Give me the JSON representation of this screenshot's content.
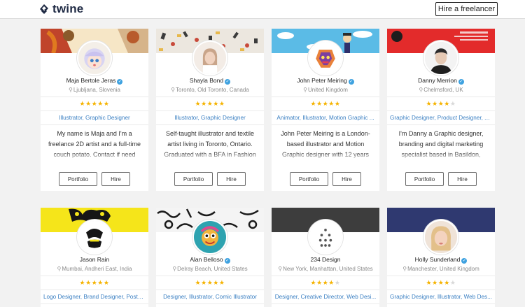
{
  "header": {
    "logo_text": "twine",
    "hire_button": "Hire a freelancer"
  },
  "labels": {
    "portfolio": "Portfolio",
    "hire": "Hire",
    "verified_mark": "✓",
    "pin": "⚲"
  },
  "cards": [
    {
      "name": "Maja Bertole Jeras",
      "location": "Ljubljana, Slovenia",
      "rating": 5,
      "skills": "Illustrator, Graphic Designer",
      "bio": "My name is Maja and I'm a freelance 2D artist and a full-time couch potato. Contact if need"
    },
    {
      "name": "Shayla Bond",
      "location": "Toronto, Old Toronto, Canada",
      "rating": 5,
      "skills": "Illustrator, Graphic Designer",
      "bio": "Self-taught illustrator and textile artist living in Toronto, Ontario. Graduated with a BFA in Fashion &"
    },
    {
      "name": "John Peter Meiring",
      "location": "United Kingdom",
      "rating": 5,
      "skills": "Animator, Illustrator, Motion Graphic ...",
      "bio": "John Peter Meiring is a London-based illustrator and Motion Graphic designer with 12 years"
    },
    {
      "name": "Danny Merrion",
      "location": "Chelmsford, UK",
      "rating": 4,
      "skills": "Graphic Designer, Product Designer, A...",
      "bio": "I'm Danny a Graphic designer, branding and digital marketing specialist based in Basildon, Essex."
    },
    {
      "name": "Jason Rain",
      "location": "Mumbai, Andheri East, India",
      "rating": 5,
      "skills": "Logo Designer, Brand Designer, Poster..."
    },
    {
      "name": "Alan Belloso",
      "location": "Delray Beach, United States",
      "rating": 5,
      "skills": "Designer, Illustrator, Comic Illustrator"
    },
    {
      "name": "234 Design",
      "location": "New York, Manhattan, United States",
      "rating": 4,
      "skills": "Designer, Creative Director, Web Desi..."
    },
    {
      "name": "Holly Sunderland",
      "location": "Manchester, United Kingdom",
      "rating": 4,
      "skills": "Graphic Designer, Illustrator, Web Des..."
    }
  ],
  "colors": {
    "accent_link": "#3a7fc2",
    "star": "#f5b301",
    "verified": "#3fa2e0",
    "page_bg": "#f2f2f2",
    "banner_danny": "#e32b2b",
    "banner_jason": "#f5e51a",
    "banner_234": "#3d3d3d",
    "banner_holly": "#2f3970"
  },
  "icons": {
    "logo": "twine-logo-icon",
    "verified": "verified-badge-icon",
    "location": "map-pin-icon",
    "star": "star-icon"
  }
}
